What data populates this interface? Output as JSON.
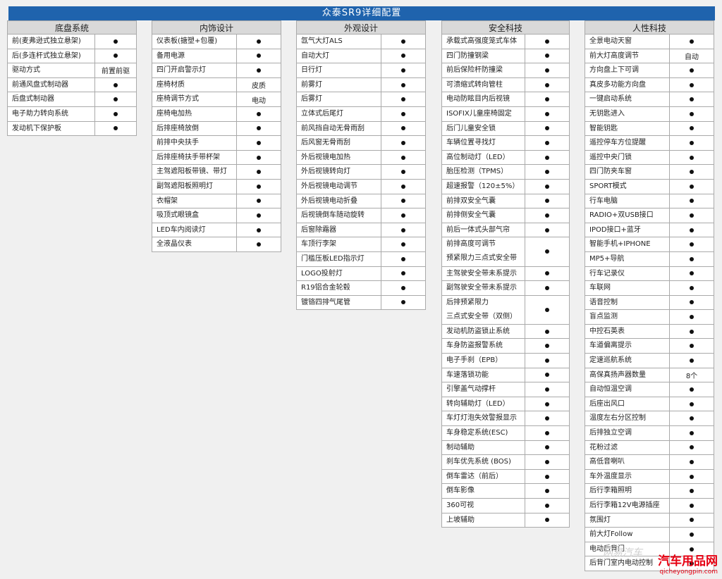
{
  "title": "众泰SR9详细配置",
  "columns": [
    {
      "header": "底盘系统",
      "rows": [
        {
          "name": "前(麦弗逊式独立悬架)",
          "value": "●"
        },
        {
          "name": "后(多连杆式独立悬架)",
          "value": "●"
        },
        {
          "name": "驱动方式",
          "value": "前置前驱"
        },
        {
          "name": "前通风盘式制动器",
          "value": "●"
        },
        {
          "name": "后盘式制动器",
          "value": "●"
        },
        {
          "name": "电子助力转向系统",
          "value": "●"
        },
        {
          "name": "发动机下保护板",
          "value": "●"
        }
      ]
    },
    {
      "header": "内饰设计",
      "rows": [
        {
          "name": "仪表板(搪塑+包覆)",
          "value": "●"
        },
        {
          "name": "备用电源",
          "value": "●"
        },
        {
          "name": "四门开启警示灯",
          "value": "●"
        },
        {
          "name": "座椅材质",
          "value": "皮质"
        },
        {
          "name": "座椅调节方式",
          "value": "电动"
        },
        {
          "name": "座椅电加热",
          "value": "●"
        },
        {
          "name": "后排座椅放倒",
          "value": "●"
        },
        {
          "name": "前排中央扶手",
          "value": "●"
        },
        {
          "name": "后排座椅扶手带杯架",
          "value": "●"
        },
        {
          "name": "主驾遮阳板带镜、带灯",
          "value": "●"
        },
        {
          "name": "副驾遮阳板照明灯",
          "value": "●"
        },
        {
          "name": "衣帽架",
          "value": "●"
        },
        {
          "name": "吸顶式眼镜盒",
          "value": "●"
        },
        {
          "name": "LED车内阅读灯",
          "value": "●"
        },
        {
          "name": "全液晶仪表",
          "value": "●"
        }
      ]
    },
    {
      "header": "外观设计",
      "rows": [
        {
          "name": "氙气大灯ALS",
          "value": "●"
        },
        {
          "name": "自动大灯",
          "value": "●"
        },
        {
          "name": "日行灯",
          "value": "●"
        },
        {
          "name": "前雾灯",
          "value": "●"
        },
        {
          "name": "后雾灯",
          "value": "●"
        },
        {
          "name": "立体式后尾灯",
          "value": "●"
        },
        {
          "name": "前风挡自动无骨雨刮",
          "value": "●"
        },
        {
          "name": "后风窗无骨雨刮",
          "value": "●"
        },
        {
          "name": "外后视镜电加热",
          "value": "●"
        },
        {
          "name": "外后视镜转向灯",
          "value": "●"
        },
        {
          "name": "外后视镜电动调节",
          "value": "●"
        },
        {
          "name": "外后视镜电动折叠",
          "value": "●"
        },
        {
          "name": "后视镜倒车随动旋转",
          "value": "●"
        },
        {
          "name": "后窗除霜器",
          "value": "●"
        },
        {
          "name": "车顶行李架",
          "value": "●"
        },
        {
          "name": "门槛压板LED指示灯",
          "value": "●"
        },
        {
          "name": "LOGO投射灯",
          "value": "●"
        },
        {
          "name": "R19铝合金轮毂",
          "value": "●"
        },
        {
          "name": "镀铬四排气尾管",
          "value": "●"
        }
      ]
    },
    {
      "header": "安全科技",
      "rows": [
        {
          "name": "承载式高强度笼式车体",
          "value": "●"
        },
        {
          "name": "四门防撞钢梁",
          "value": "●"
        },
        {
          "name": "前后保险杆防撞梁",
          "value": "●"
        },
        {
          "name": "可溃缩式转向管柱",
          "value": "●"
        },
        {
          "name": "电动防眩目内后视镜",
          "value": "●"
        },
        {
          "name": "ISOFIX儿童座椅固定",
          "value": "●"
        },
        {
          "name": "后门儿童安全锁",
          "value": "●"
        },
        {
          "name": "车辆位置寻找灯",
          "value": "●"
        },
        {
          "name": "高位制动灯（LED）",
          "value": "●"
        },
        {
          "name": "胎压检测（TPMS）",
          "value": "●"
        },
        {
          "name": "超速报警（120±5%）",
          "value": "●"
        },
        {
          "name": "前排双安全气囊",
          "value": "●"
        },
        {
          "name": "前排侧安全气囊",
          "value": "●"
        },
        {
          "name": "前后一体式头部气帘",
          "value": "●"
        },
        {
          "name": "前排高度可调节",
          "name2": "预紧限力三点式安全带",
          "value": "●",
          "tall": true
        },
        {
          "name": "主驾驶安全带未系提示",
          "value": "●"
        },
        {
          "name": "副驾驶安全带未系提示",
          "value": "●"
        },
        {
          "name": "后排预紧限力",
          "name2": "三点式安全带（双侧）",
          "value": "●",
          "tall": true
        },
        {
          "name": "发动机防盗锁止系统",
          "value": "●"
        },
        {
          "name": "车身防盗报警系统",
          "value": "●"
        },
        {
          "name": "电子手刹（EPB）",
          "value": "●"
        },
        {
          "name": "车速落锁功能",
          "value": "●"
        },
        {
          "name": "引擎盖气动撑杆",
          "value": "●"
        },
        {
          "name": "转向辅助灯（LED）",
          "value": "●"
        },
        {
          "name": "车灯灯泡失效警报显示",
          "value": "●"
        },
        {
          "name": "车身稳定系统(ESC)",
          "value": "●"
        },
        {
          "name": "制动辅助",
          "value": "●"
        },
        {
          "name": "刹车优先系统 (BOS)",
          "value": "●"
        },
        {
          "name": "倒车雷达（前后）",
          "value": "●"
        },
        {
          "name": "倒车影像",
          "value": "●"
        },
        {
          "name": "360可视",
          "value": "●"
        },
        {
          "name": "上坡辅助",
          "value": "●"
        }
      ]
    },
    {
      "header": "人性科技",
      "rows": [
        {
          "name": "全景电动天窗",
          "value": "●"
        },
        {
          "name": "前大灯高度调节",
          "value": "自动"
        },
        {
          "name": "方向盘上下可调",
          "value": "●"
        },
        {
          "name": "真皮多功能方向盘",
          "value": "●"
        },
        {
          "name": "一键启动系统",
          "value": "●"
        },
        {
          "name": "无钥匙进入",
          "value": "●"
        },
        {
          "name": "智能钥匙",
          "value": "●"
        },
        {
          "name": "遥控停车方位提醒",
          "value": "●"
        },
        {
          "name": "遥控中央门锁",
          "value": "●"
        },
        {
          "name": "四门防夹车窗",
          "value": "●"
        },
        {
          "name": "SPORT模式",
          "value": "●"
        },
        {
          "name": "行车电脑",
          "value": "●"
        },
        {
          "name": "RADIO+双USB接口",
          "value": "●"
        },
        {
          "name": "IPOD接口+蓝牙",
          "value": "●"
        },
        {
          "name": "智能手机+IPHONE",
          "value": "●"
        },
        {
          "name": "MP5+导航",
          "value": "●"
        },
        {
          "name": "行车记录仪",
          "value": "●"
        },
        {
          "name": "车联网",
          "value": "●"
        },
        {
          "name": "语音控制",
          "value": "●"
        },
        {
          "name": "盲点监测",
          "value": "●"
        },
        {
          "name": "中控石英表",
          "value": "●"
        },
        {
          "name": "车道偏离提示",
          "value": "●"
        },
        {
          "name": "定速巡航系统",
          "value": "●"
        },
        {
          "name": "高保真扬声器数量",
          "value": "8个"
        },
        {
          "name": "自动恒温空调",
          "value": "●"
        },
        {
          "name": "后座出风口",
          "value": "●"
        },
        {
          "name": "温度左右分区控制",
          "value": "●"
        },
        {
          "name": "后排独立空调",
          "value": "●"
        },
        {
          "name": "花粉过滤",
          "value": "●"
        },
        {
          "name": "高低音喇叭",
          "value": "●"
        },
        {
          "name": "车外温度显示",
          "value": "●"
        },
        {
          "name": "后行李箱照明",
          "value": "●"
        },
        {
          "name": "后行李箱12V电源插座",
          "value": "●"
        },
        {
          "name": "氛围灯",
          "value": "●"
        },
        {
          "name": "前大灯Follow",
          "value": "●"
        },
        {
          "name": "电动后背门",
          "value": "●"
        },
        {
          "name": "后背门室内电动控制",
          "value": "●"
        }
      ]
    }
  ],
  "watermark": {
    "main": "汽车用品网",
    "url": "qicheyongpin.com",
    "faint": "网易汽车"
  }
}
